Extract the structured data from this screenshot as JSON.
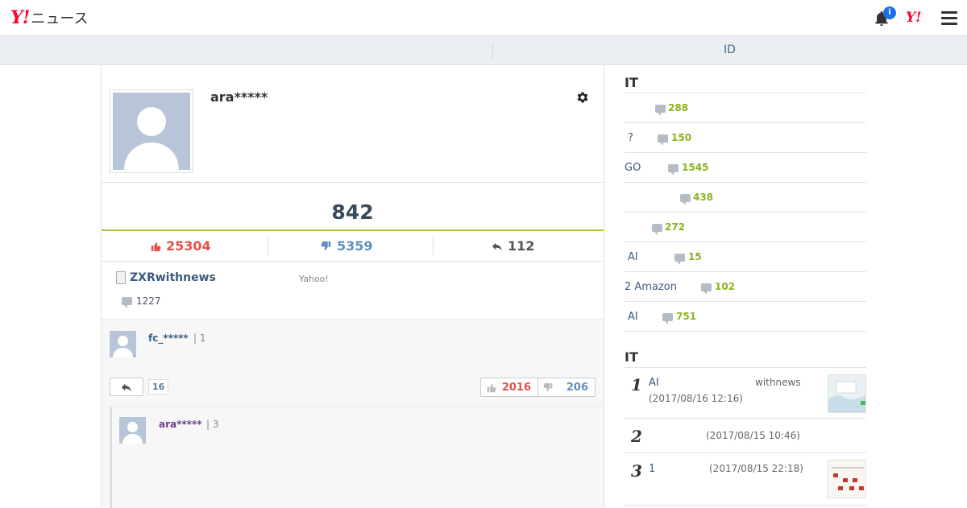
{
  "header": {
    "logo_mark": "Y!",
    "logo_text": "ニュース",
    "notification_count": "i",
    "yahoo_mark": "Y!"
  },
  "subnav": {
    "id_tab": "ID"
  },
  "profile": {
    "username": "ara*****",
    "comment_total": "842",
    "likes": "25304",
    "dislikes": "5359",
    "replies": "112"
  },
  "article": {
    "title": "ZXRwithnews",
    "source": "Yahoo!",
    "comment_count": "1227"
  },
  "thread": {
    "reply": {
      "user": "fc_*****",
      "meta": "| 1",
      "reply_count": "16",
      "likes": "2016",
      "dislikes": "206"
    },
    "nested": {
      "user": "ara*****",
      "meta": "| 3"
    }
  },
  "sidebar": {
    "comment_ranking_title": "IT",
    "comment_ranking": [
      {
        "prefix": "",
        "count": "288"
      },
      {
        "prefix": "?",
        "count": "150"
      },
      {
        "prefix": "GO",
        "count": "1545"
      },
      {
        "prefix": "",
        "count": "438"
      },
      {
        "prefix": "",
        "count": "272"
      },
      {
        "prefix": "AI",
        "count": "15"
      },
      {
        "prefix": "2 Amazon",
        "count": "102"
      },
      {
        "prefix": "AI",
        "count": "751"
      }
    ],
    "access_ranking_title": "IT",
    "access_ranking": [
      {
        "rank": "1",
        "title": "AI",
        "source": "withnews",
        "date": "(2017/08/16 12:16)"
      },
      {
        "rank": "2",
        "title": "",
        "source": "",
        "date": "(2017/08/15 10:46)"
      },
      {
        "rank": "3",
        "title": "1",
        "source": "",
        "date": "(2017/08/15 22:18)"
      }
    ]
  },
  "colors": {
    "like": "#e0534a",
    "dislike": "#5f8fbe",
    "comment_count": "#8bb21e",
    "accent_line": "#a7c83c",
    "brand": "#ff0033"
  }
}
